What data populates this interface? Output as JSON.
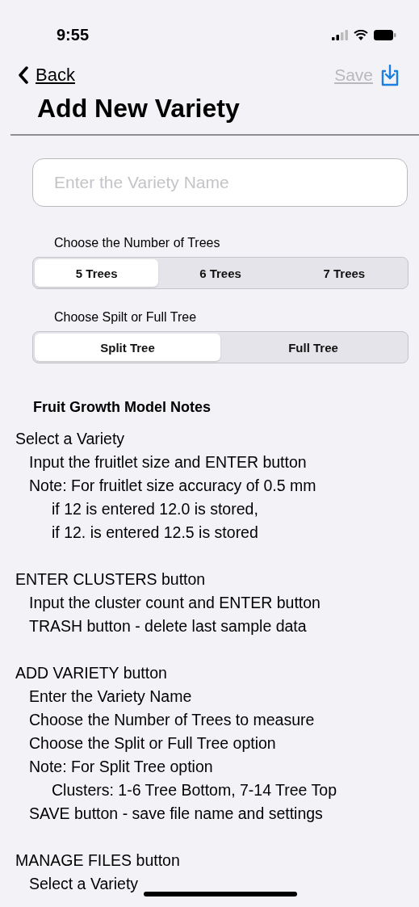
{
  "status_bar": {
    "time": "9:55"
  },
  "nav": {
    "back": "Back",
    "save": "Save",
    "save_disabled": true,
    "title": "Add New Variety"
  },
  "name_field": {
    "placeholder": "Enter the Variety Name"
  },
  "tree_count": {
    "label": "Choose the Number of Trees",
    "options": [
      {
        "label": "5 Trees",
        "selected": true
      },
      {
        "label": "6 Trees",
        "selected": false
      },
      {
        "label": "7 Trees",
        "selected": false
      }
    ]
  },
  "tree_type": {
    "label": "Choose Spilt or Full Tree",
    "options": [
      {
        "label": "Split Tree",
        "selected": true
      },
      {
        "label": "Full Tree",
        "selected": false
      }
    ]
  },
  "notes": {
    "title": "Fruit Growth Model Notes",
    "sections": [
      {
        "text": "Select a Variety",
        "children": [
          {
            "text": "Input the fruitlet size and ENTER button"
          },
          {
            "text": "Note: For fruitlet size accuracy of 0.5 mm",
            "children": [
              {
                "text": "if 12 is entered 12.0 is stored,"
              },
              {
                "text": "if 12. is entered 12.5 is stored"
              }
            ]
          }
        ]
      },
      {
        "text": "ENTER CLUSTERS button",
        "children": [
          {
            "text": "Input the cluster count and ENTER button"
          },
          {
            "text": "TRASH button - delete last sample data"
          }
        ]
      },
      {
        "text": "ADD VARIETY button",
        "children": [
          {
            "text": "Enter the Variety Name"
          },
          {
            "text": "Choose the Number of Trees to measure"
          },
          {
            "text": "Choose the Split or Full Tree option"
          },
          {
            "text": "Note: For Split Tree option",
            "children": [
              {
                "text": "Clusters: 1-6 Tree Bottom, 7-14 Tree Top"
              }
            ]
          },
          {
            "text": "SAVE button - save file name and settings"
          }
        ]
      },
      {
        "text": "MANAGE FILES button",
        "children": [
          {
            "text": "Select a Variety"
          }
        ]
      }
    ]
  }
}
